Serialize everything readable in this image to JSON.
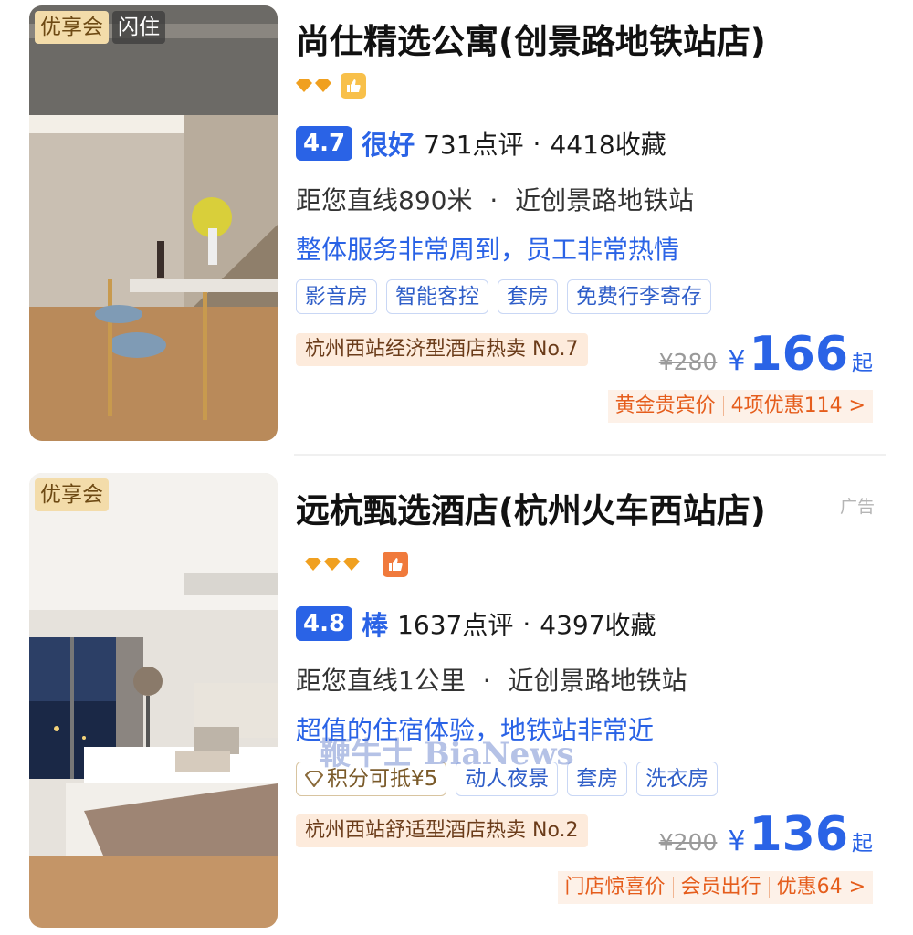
{
  "hotels": [
    {
      "badges": [
        "优享会",
        "闪住"
      ],
      "name": "尚仕精选公寓(创景路地铁站店)",
      "star_icon": "diamond-icon",
      "star_count": 2,
      "score": "4.7",
      "grade": "很好",
      "reviews": "731点评",
      "favorites": "4418收藏",
      "distance": "距您直线890米",
      "nearby": "近创景路地铁站",
      "review_snippet": "整体服务非常周到，员工非常热情",
      "tags": [
        "影音房",
        "智能客控",
        "套房",
        "免费行李寄存"
      ],
      "rank": "杭州西站经济型酒店热卖 No.7",
      "original_price": "¥280",
      "currency": "¥",
      "price": "166",
      "price_suffix": "起",
      "promos": [
        "黄金贵宾价",
        "4项优惠114 >"
      ],
      "colors": {
        "thumb": "#f8c04a"
      }
    },
    {
      "badges": [
        "优享会"
      ],
      "name": "远杭甄选酒店(杭州火车西站店)",
      "star_icon": "diamond-icon",
      "star_count": 3,
      "ad_label": "广告",
      "score": "4.8",
      "grade": "棒",
      "reviews": "1637点评",
      "favorites": "4397收藏",
      "distance": "距您直线1公里",
      "nearby": "近创景路地铁站",
      "review_snippet": "超值的住宿体验，地铁站非常近",
      "points_tag": "积分可抵¥5",
      "tags": [
        "动人夜景",
        "套房",
        "洗衣房"
      ],
      "rank": "杭州西站舒适型酒店热卖 No.2",
      "original_price": "¥200",
      "currency": "¥",
      "price": "136",
      "price_suffix": "起",
      "promos": [
        "门店惊喜价",
        "会员出行",
        "优惠64 >"
      ],
      "colors": {
        "thumb": "#f07a3c"
      }
    }
  ],
  "watermark": "鞭牛士 BiaNews",
  "dot_separator": "·",
  "colors": {
    "accent": "#2a63e6",
    "promo": "#e55d1c",
    "diamond": "#f0a020"
  }
}
